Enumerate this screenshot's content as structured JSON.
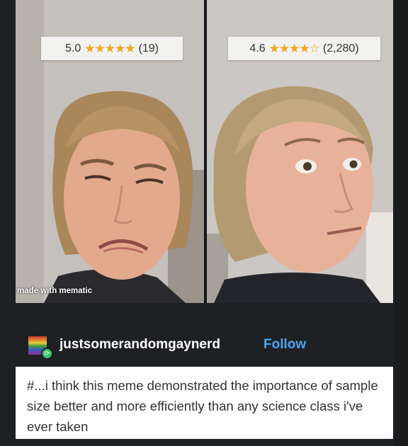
{
  "meme": {
    "left_rating": {
      "score": "5.0",
      "stars": "★★★★★",
      "count": "(19)"
    },
    "right_rating": {
      "score": "4.6",
      "stars": "★★★★☆",
      "count": "(2,280)"
    },
    "watermark": "made with mematic"
  },
  "post": {
    "username": "justsomerandomgaynerd",
    "follow_label": "Follow",
    "tag_text": "#...i think this meme demonstrated the importance of sample size better and more efficiently than any science class i've ever taken"
  },
  "colors": {
    "star": "#f0a51b",
    "follow": "#4aa6f0",
    "background": "#1e2024"
  }
}
